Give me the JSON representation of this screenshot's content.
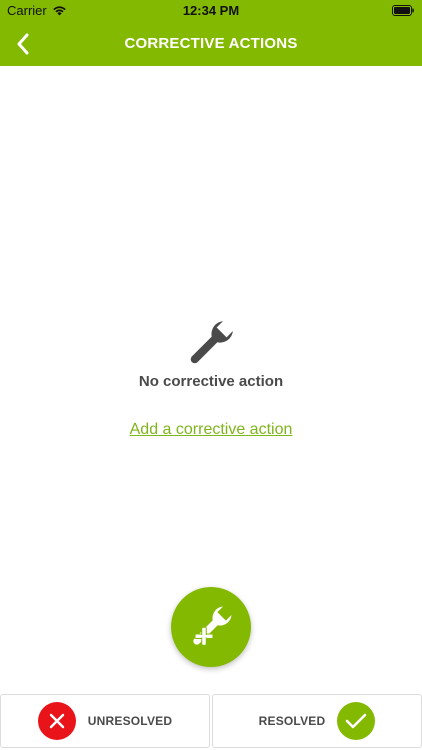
{
  "status_bar": {
    "carrier": "Carrier",
    "time": "12:34 PM"
  },
  "header": {
    "title": "CORRECTIVE ACTIONS",
    "back_icon": "chevron-left-icon"
  },
  "empty_state": {
    "icon": "wrench-icon",
    "message": "No corrective action",
    "link_label": "Add a corrective action"
  },
  "fab": {
    "icon": "wrench-plus-icon"
  },
  "bottom_buttons": {
    "unresolved": {
      "label": "UNRESOLVED",
      "icon": "close-icon",
      "color": "#e8141a"
    },
    "resolved": {
      "label": "RESOLVED",
      "icon": "check-icon",
      "color": "#84b902"
    }
  },
  "colors": {
    "accent": "#84b902",
    "link": "#7fb41c",
    "danger": "#e8141a",
    "text": "#4a4a4a"
  }
}
